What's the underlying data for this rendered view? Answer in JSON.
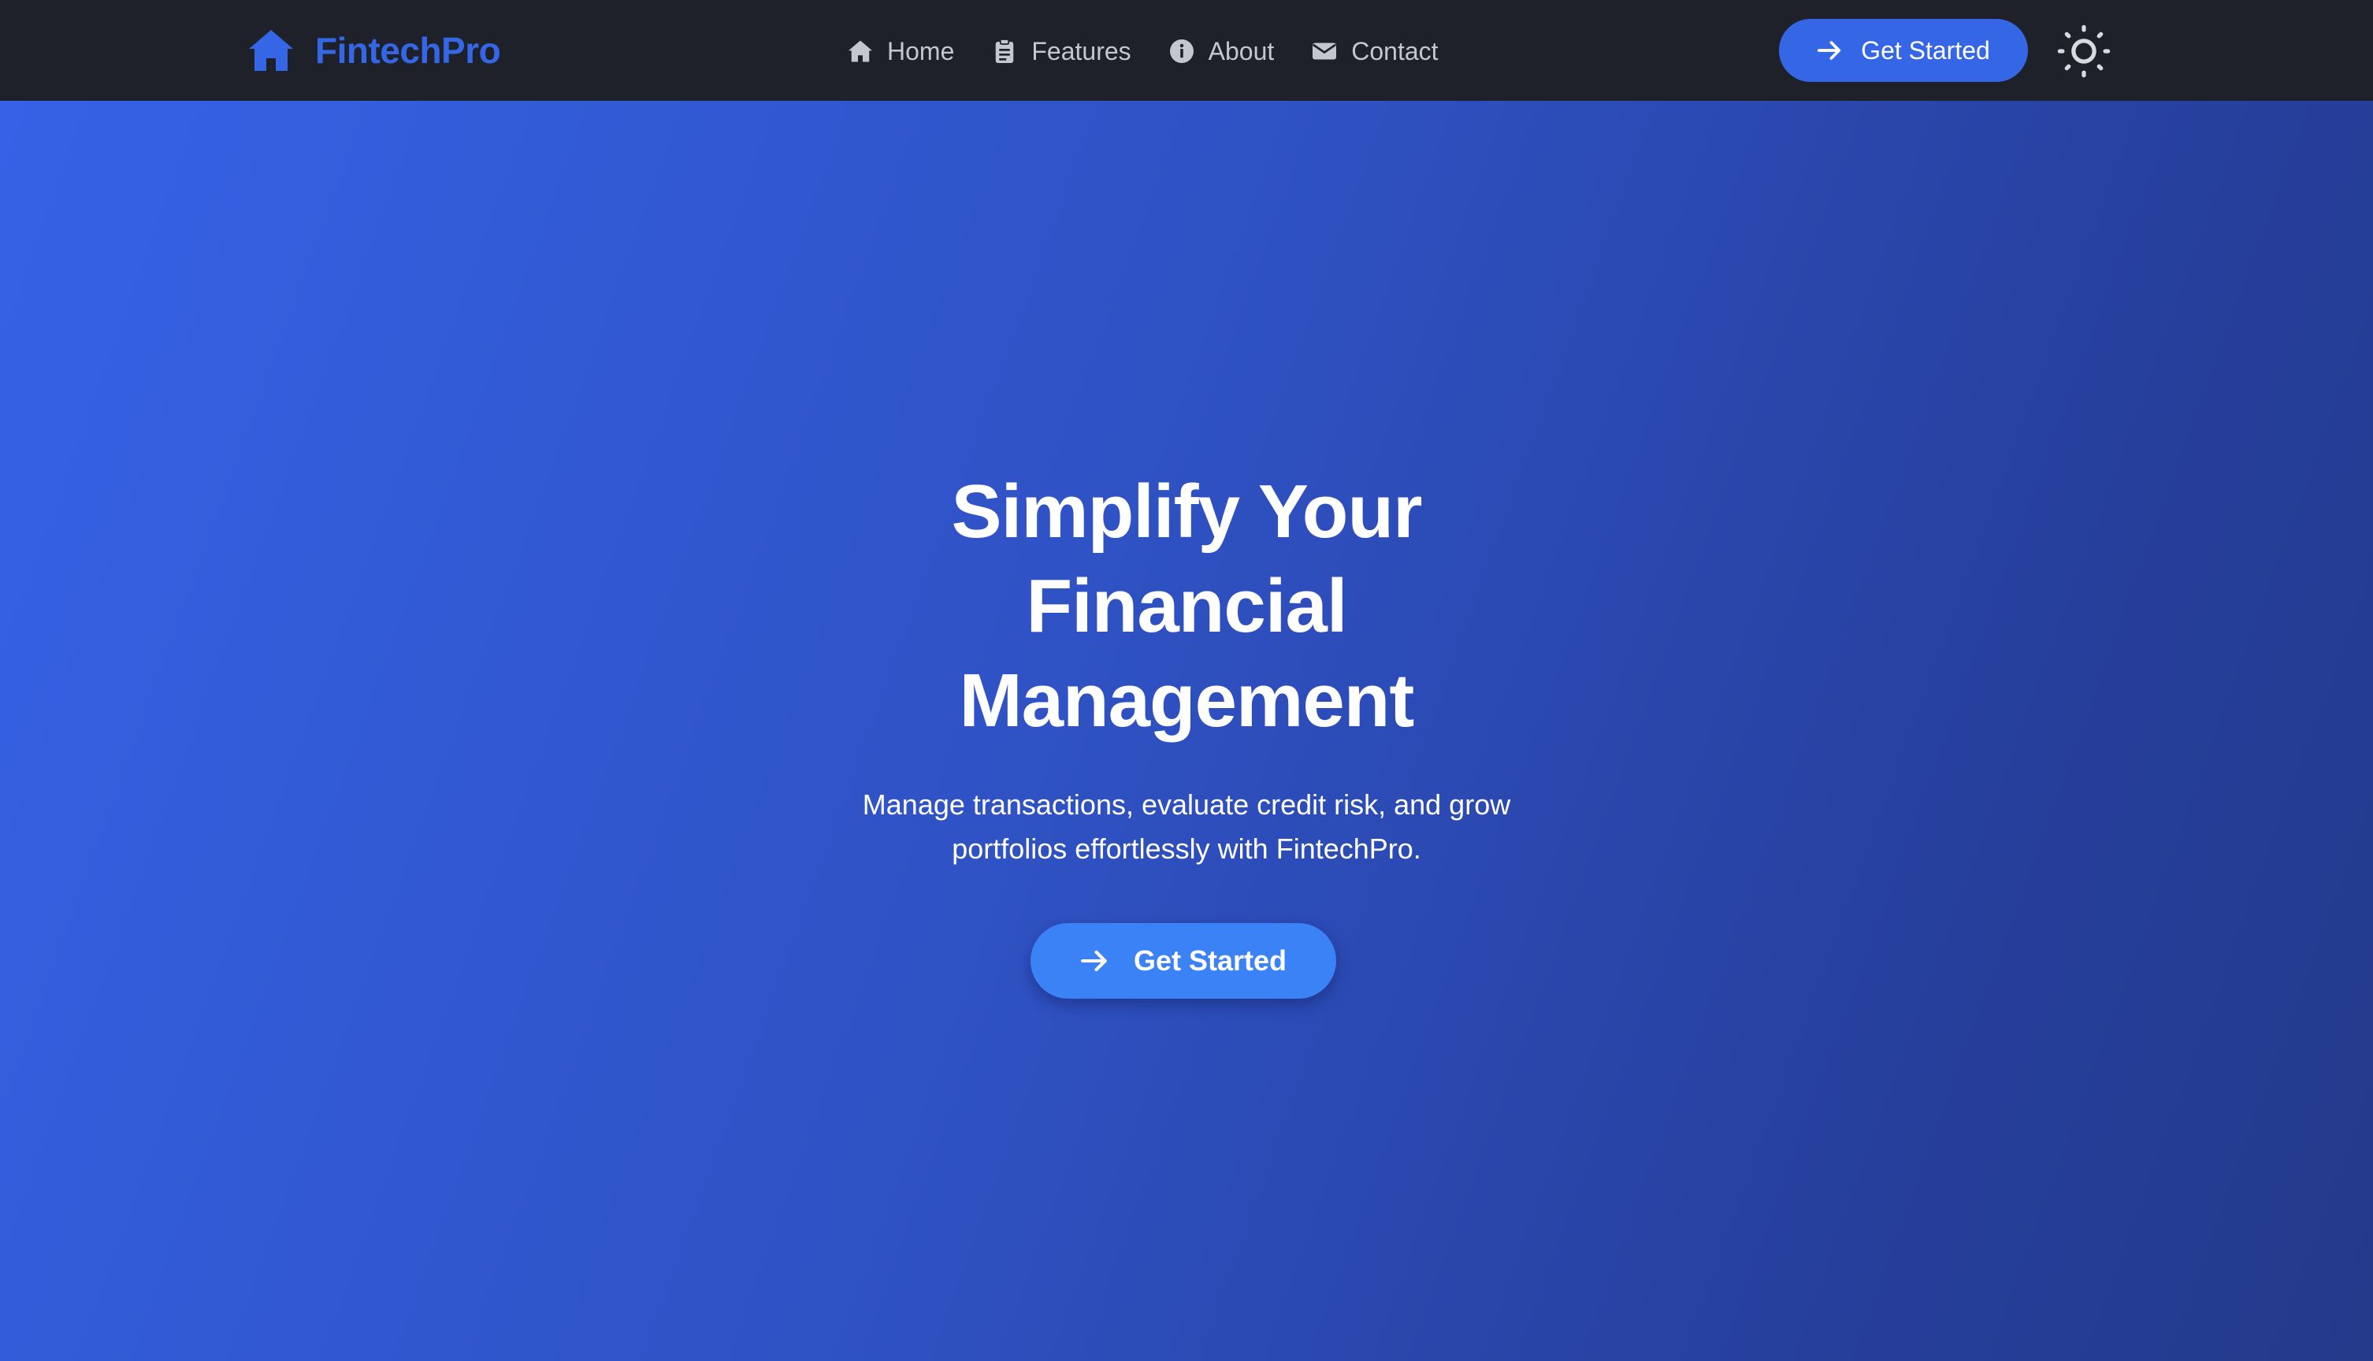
{
  "navbar": {
    "brand": {
      "name": "FintechPro",
      "icon": "home-icon"
    },
    "links": [
      {
        "label": "Home",
        "icon": "home-icon"
      },
      {
        "label": "Features",
        "icon": "clipboard-icon"
      },
      {
        "label": "About",
        "icon": "info-circle-icon"
      },
      {
        "label": "Contact",
        "icon": "envelope-icon"
      }
    ],
    "cta": {
      "label": "Get Started",
      "icon": "arrow-right-icon"
    },
    "theme_toggle": {
      "icon": "sun-icon"
    }
  },
  "hero": {
    "title_lines": [
      "Simplify Your",
      "Financial",
      "Management"
    ],
    "subtitle_lines": [
      "Manage transactions, evaluate credit risk, and grow",
      "portfolios effortlessly with FintechPro."
    ],
    "cta": {
      "label": "Get Started",
      "icon": "arrow-right-icon"
    }
  },
  "colors": {
    "navbar_bg": "#1e2129",
    "brand": "#3566e6",
    "nav_link": "#c3c7cf",
    "nav_cta_bg": "#3566e6",
    "hero_gradient_start": "#3562e6",
    "hero_gradient_end": "#233a8a",
    "hero_cta_bg": "#3b82f6",
    "text_light": "#ffffff"
  }
}
